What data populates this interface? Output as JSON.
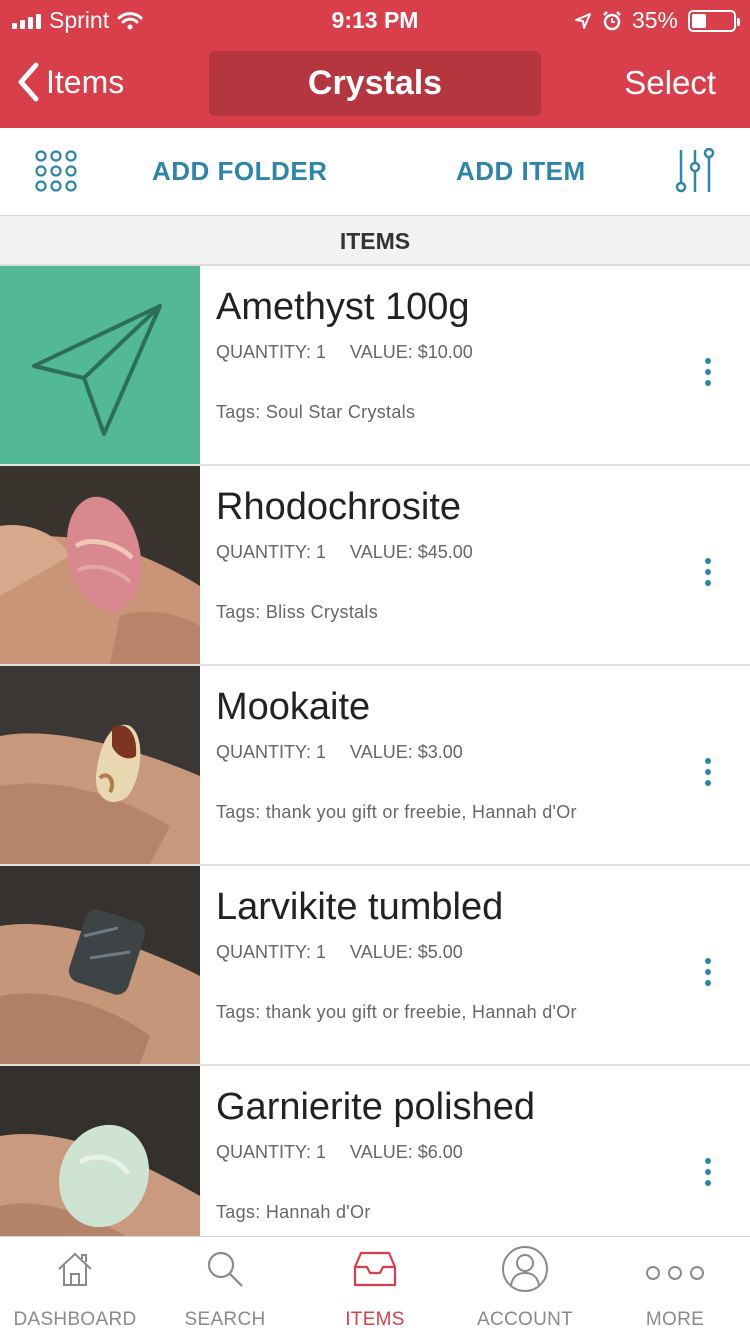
{
  "status": {
    "carrier": "Sprint",
    "time": "9:13 PM",
    "battery": "35%",
    "battery_level": 0.35
  },
  "nav": {
    "back_label": "Items",
    "title": "Crystals",
    "select_label": "Select"
  },
  "toolbar": {
    "add_folder": "ADD FOLDER",
    "add_item": "ADD ITEM"
  },
  "section": {
    "title": "ITEMS"
  },
  "items": [
    {
      "name": "Amethyst 100g",
      "quantity": "QUANTITY: 1",
      "value": "VALUE: $10.00",
      "tags": "Tags: Soul Star Crystals",
      "thumb": "paper-plane-placeholder"
    },
    {
      "name": "Rhodochrosite",
      "quantity": "QUANTITY: 1",
      "value": "VALUE: $45.00",
      "tags": "Tags: Bliss Crystals",
      "thumb": "photo"
    },
    {
      "name": "Mookaite",
      "quantity": "QUANTITY: 1",
      "value": "VALUE: $3.00",
      "tags": "Tags: thank you gift or freebie, Hannah d'Or",
      "thumb": "photo"
    },
    {
      "name": "Larvikite tumbled",
      "quantity": "QUANTITY: 1",
      "value": "VALUE: $5.00",
      "tags": "Tags: thank you gift or freebie, Hannah d'Or",
      "thumb": "photo"
    },
    {
      "name": "Garnierite polished",
      "quantity": "QUANTITY: 1",
      "value": "VALUE: $6.00",
      "tags": "Tags: Hannah d'Or",
      "thumb": "photo"
    }
  ],
  "tabs": [
    {
      "label": "DASHBOARD",
      "icon": "house-icon"
    },
    {
      "label": "SEARCH",
      "icon": "search-icon"
    },
    {
      "label": "ITEMS",
      "icon": "inbox-tray-icon",
      "active": true
    },
    {
      "label": "ACCOUNT",
      "icon": "user-circle-icon"
    },
    {
      "label": "MORE",
      "icon": "ellipsis-icon"
    }
  ],
  "colors": {
    "brand_red": "#d93f4a",
    "title_pill": "#b5363f",
    "accent_blue": "#2f84aa",
    "placeholder_teal": "#52b898"
  }
}
